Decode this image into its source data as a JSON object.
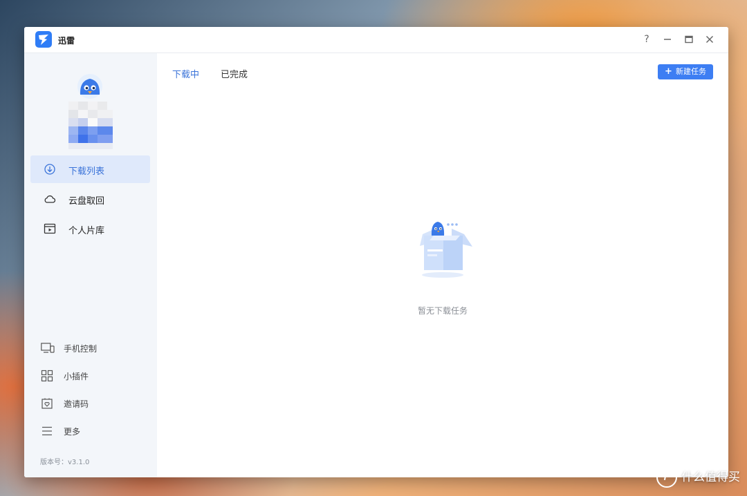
{
  "window": {
    "title": "迅雷",
    "controls": {
      "help": "?",
      "minimize": "—",
      "maximize": "🗖",
      "close": "✕"
    }
  },
  "sidebar": {
    "nav": [
      {
        "label": "下载列表",
        "icon": "download-circle-icon",
        "active": true
      },
      {
        "label": "云盘取回",
        "icon": "cloud-icon",
        "active": false
      },
      {
        "label": "个人片库",
        "icon": "video-library-icon",
        "active": false
      }
    ],
    "bottom": [
      {
        "label": "手机控制",
        "icon": "devices-icon"
      },
      {
        "label": "小插件",
        "icon": "grid-icon"
      },
      {
        "label": "邀请码",
        "icon": "gift-icon"
      },
      {
        "label": "更多",
        "icon": "menu-icon"
      }
    ],
    "version": "版本号：v3.1.0"
  },
  "main": {
    "tabs": [
      {
        "label": "下载中",
        "active": true
      },
      {
        "label": "已完成",
        "active": false
      }
    ],
    "new_task_label": "新建任务",
    "empty_text": "暂无下载任务"
  },
  "watermark": "什么值得买",
  "colors": {
    "accent": "#3d7ef3",
    "sidebar_bg": "#f3f6fa",
    "active_bg": "#dfe9fb"
  }
}
